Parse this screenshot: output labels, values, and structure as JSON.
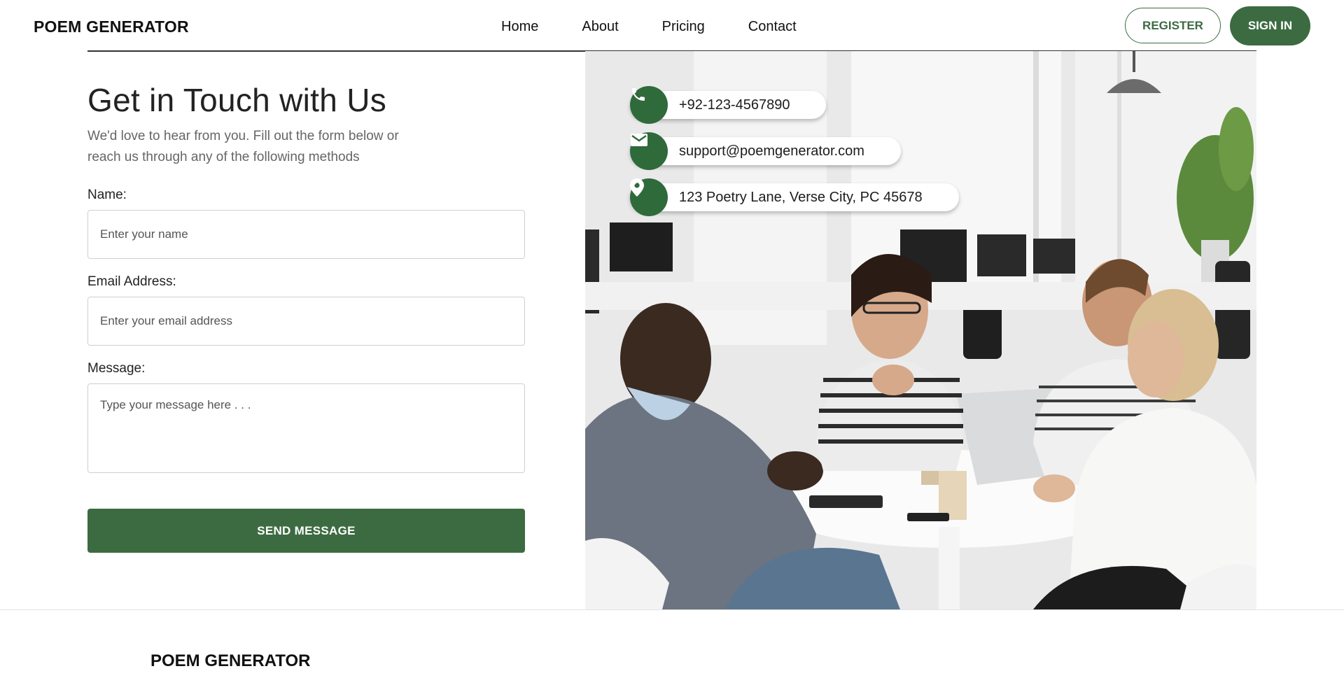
{
  "header": {
    "logo": "POEM GENERATOR",
    "nav": [
      "Home",
      "About",
      "Pricing",
      "Contact"
    ],
    "register_label": "REGISTER",
    "signin_label": "SIGN IN"
  },
  "contact_form": {
    "title": "Get in Touch with Us",
    "subtitle": "We'd love to hear from you. Fill out the form below or reach us through any of the following methods",
    "name_label": "Name:",
    "name_placeholder": "Enter your name",
    "email_label": "Email Address:",
    "email_placeholder": "Enter your email address",
    "message_label": "Message:",
    "message_placeholder": "Type your message here . . .",
    "send_label": "SEND MESSAGE"
  },
  "contact_info": {
    "phone": "+92-123-4567890",
    "email": "support@poemgenerator.com",
    "address": "123 Poetry Lane, Verse City, PC 45678",
    "icons": [
      "phone-icon",
      "mail-icon",
      "location-pin-icon"
    ],
    "accent_color": "#2f6a3a"
  },
  "footer": {
    "logo": "POEM GENERATOR"
  },
  "colors": {
    "primary": "#3c6b42",
    "text": "#222222",
    "muted": "#666666"
  }
}
